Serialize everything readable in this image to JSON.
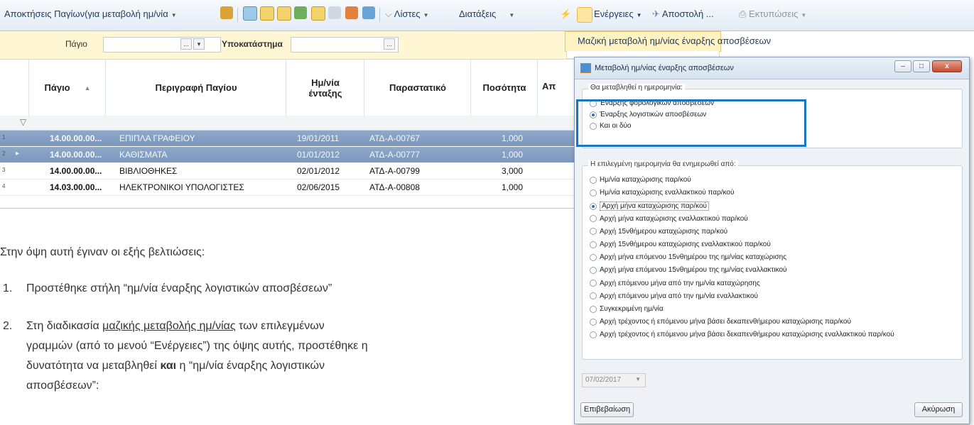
{
  "toolbar": {
    "view_name": "Αποκτήσεις Παγίων(για μεταβολή ημ/νία",
    "lists": "Λίστες",
    "orders": "Διατάξεις",
    "actions": "Ενέργειες",
    "send": "Αποστολή ...",
    "prints": "Εκτυπώσεις"
  },
  "menu": {
    "bulk_change": "Μαζική μεταβολή ημ/νίας έναρξης αποσβέσεων"
  },
  "filters": {
    "asset_label": "Πάγιο",
    "branch_label": "Υποκατάστημα",
    "asset_btn_1": "...",
    "asset_btn_2": "▾",
    "branch_btn": "..."
  },
  "grid": {
    "columns": [
      "Πάγιο",
      "Περιγραφή Παγίου",
      "Ημ/νία ένταξης",
      "Παραστατικό",
      "Ποσότητα",
      "Απ"
    ],
    "rows": [
      {
        "num": "1",
        "code": "14.00.00.00...",
        "desc": "ΕΠΙΠΛΑ ΓΡΑΦΕΙΟΥ",
        "date": "19/01/2011",
        "doc": "ΑΤΔ-Α-00767",
        "qty": "1,000"
      },
      {
        "num": "2",
        "code": "14.00.00.00...",
        "desc": "ΚΑΘΙΣΜΑΤΑ",
        "date": "01/01/2012",
        "doc": "ΑΤΔ-Α-00777",
        "qty": "1,000"
      },
      {
        "num": "3",
        "code": "14.00.00.00...",
        "desc": "ΒΙΒΛΙΟΘΗΚΕΣ",
        "date": "02/01/2012",
        "doc": "ΑΤΔ-Α-00799",
        "qty": "3,000"
      },
      {
        "num": "4",
        "code": "14.03.00.00...",
        "desc": "ΗΛΕΚΤΡΟΝΙΚΟΙ ΥΠΟΛΟΓΙΣΤΕΣ",
        "date": "02/06/2015",
        "doc": "ΑΤΔ-Α-00808",
        "qty": "1,000"
      }
    ]
  },
  "text": {
    "intro": "Στην όψη αυτή έγιναν οι εξής βελτιώσεις:",
    "item1_num": "1.",
    "item1": "Προστέθηκε στήλη “ημ/νία έναρξης λογιστικών αποσβέσεων”",
    "item2_num": "2.",
    "item2_a": "Στη διαδικασία ",
    "item2_link": "μαζικής μεταβολής ημ/νίας",
    "item2_b": " των επιλεγμένων",
    "item2_line2": "γραμμών (από το μενού “Ενέργειες”) της όψης αυτής, προστέθηκε η",
    "item2_line3a": "δυνατότητα να μεταβληθεί ",
    "item2_line3_bold": "και",
    "item2_line3b": " η “ημ/νία έναρξης λογιστικών",
    "item2_line4": "αποσβέσεων”:"
  },
  "dialog": {
    "title": "Μεταβολή ημ/νίας έναρξης αποσβέσεων",
    "group1_label": "Θα μεταβληθεί η ημερομηνία:",
    "group1_options": [
      "Έναρξης φορολογικών αποσβέσεων",
      "Έναρξης λογιστικών αποσβέσεων",
      "Και οι δύο"
    ],
    "group1_selected": 1,
    "group2_label": "Η επιλεγμένη ημερομηνία θα ενημερωθεί από:",
    "group2_options": [
      "Ημ/νία καταχώρισης παρ/κού",
      "Ημ/νία καταχώρισης εναλλακτικού παρ/κού",
      "Αρχή μήνα καταχώρισης παρ/κού",
      "Αρχή μήνα καταχώρισης εναλλακτικού παρ/κού",
      "Αρχή 15νθήμερου καταχώρισης παρ/κού",
      "Αρχή 15νθήμερου καταχώρισης εναλλακτικού παρ/κού",
      "Αρχή μήνα επόμενου 15νθημέρου της ημ/νίας καταχώρισης",
      "Αρχή μήνα επόμενου 15νθημέρου της ημ/νίας εναλλακτικού",
      "Αρχή επόμενου μήνα από την ημ/νία καταχώρησης",
      "Αρχή επόμενου μήνα από την ημ/νία εναλλακτικού",
      "Συγκεκριμένη ημ/νία",
      "Αρχή τρέχοντος ή επόμενου μήνα βάσει δεκαπενθήμερου καταχώρισης παρ/κού",
      "Αρχή τρέχοντος ή επόμενου μήνα βάσει δεκαπενθήμερου καταχώρισης εναλλακτικού παρ/κού"
    ],
    "group2_selected": 2,
    "date_value": "07/02/2017",
    "confirm": "Επιβεβαίωση",
    "cancel": "Ακύρωση"
  },
  "colors": {
    "highlight": "#1976c4",
    "selected_row": "#7e99be",
    "filter_bar": "#fff6d4"
  }
}
